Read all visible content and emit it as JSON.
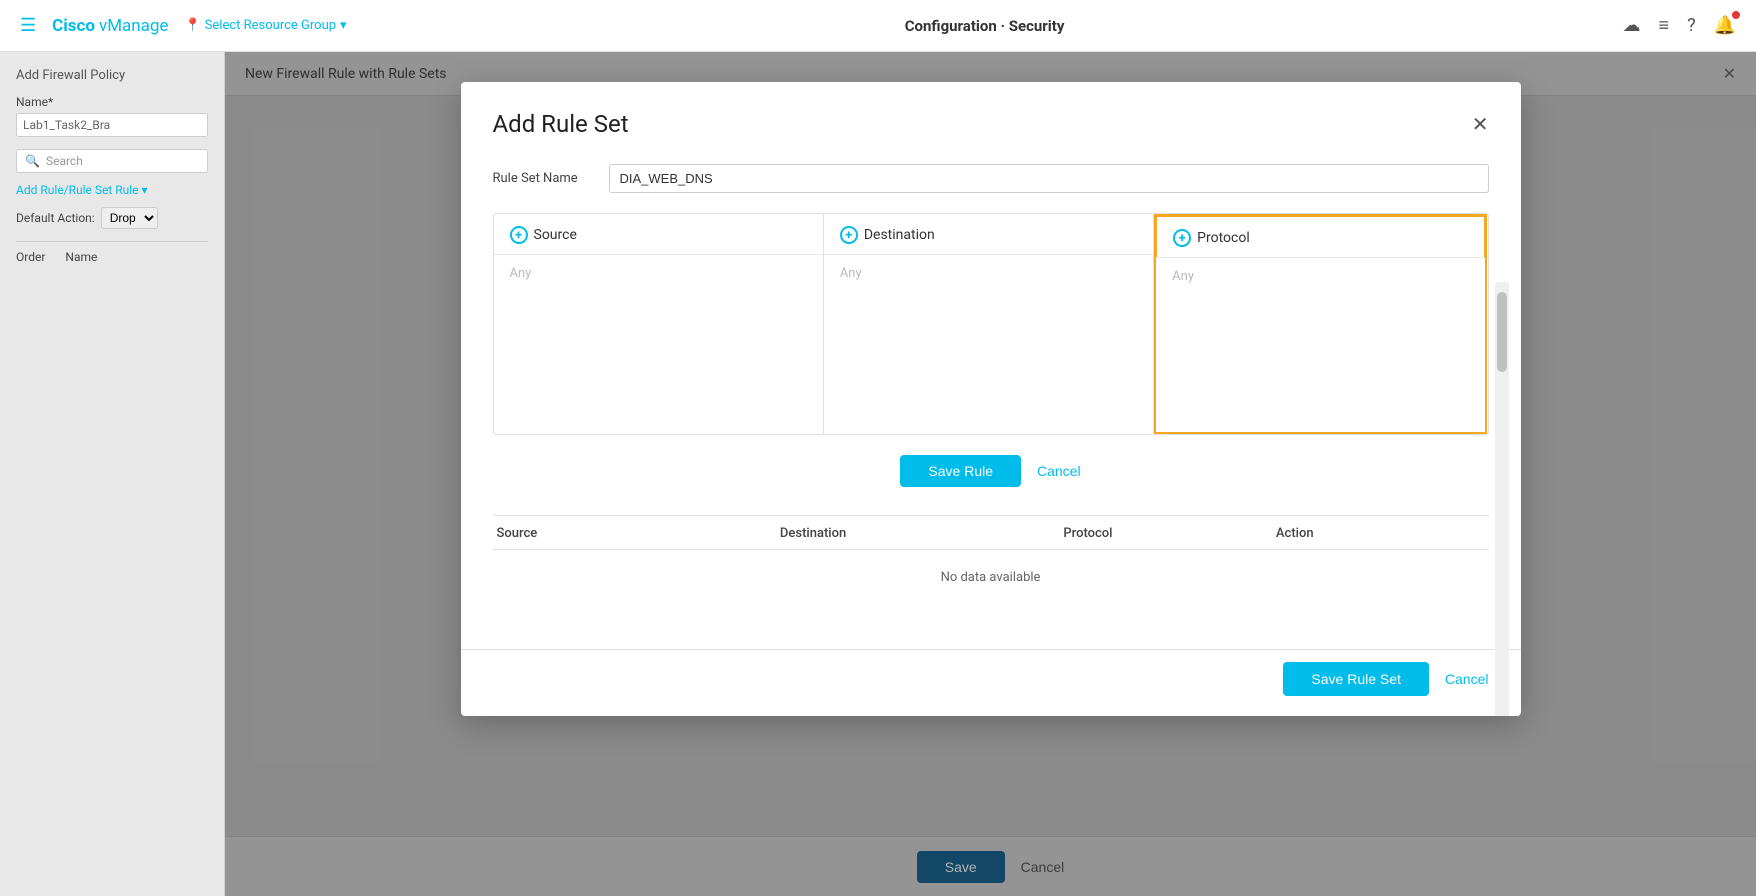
{
  "topbar": {
    "hamburger_label": "☰",
    "brand_cisco": "Cisco",
    "brand_vmanage": " vManage",
    "resource_group_label": "Select Resource Group",
    "resource_group_arrow": "▾",
    "nav_title": "Configuration · ",
    "nav_title_bold": "Security",
    "cloud_icon": "☁",
    "menu_icon": "≡",
    "help_icon": "?",
    "bell_icon": "🔔"
  },
  "background": {
    "sidebar_title": "Add Firewall Policy",
    "main_tab_title": "New Firewall Rule with Rule Sets",
    "close_icon": "✕",
    "name_label": "Name*",
    "name_value": "Lab1_Task2_Bra",
    "search_placeholder": "Search",
    "add_rule_label": "Add Rule/Rule Set Rule ▾",
    "default_action_label": "Default Action:",
    "default_action_value": "Drop",
    "table_order": "Order",
    "table_name": "Name",
    "bottom_save": "Save",
    "bottom_cancel": "Cancel"
  },
  "modal": {
    "title": "Add Rule Set",
    "close_icon": "✕",
    "rule_set_name_label": "Rule Set Name",
    "rule_set_name_value": "DIA_WEB_DNS",
    "source_label": "Source",
    "source_placeholder": "Any",
    "destination_label": "Destination",
    "destination_placeholder": "Any",
    "protocol_label": "Protocol",
    "protocol_placeholder": "Any",
    "save_rule_button": "Save Rule",
    "cancel_rule_button": "Cancel",
    "table": {
      "source_col": "Source",
      "destination_col": "Destination",
      "protocol_col": "Protocol",
      "action_col": "Action",
      "no_data": "No data available"
    },
    "save_rule_set_button": "Save Rule Set",
    "cancel_rule_set_button": "Cancel"
  },
  "colors": {
    "cisco_blue": "#00bceb",
    "protocol_highlight": "#f5a623",
    "save_button": "#00bceb",
    "bottom_save": "#1a6696"
  }
}
